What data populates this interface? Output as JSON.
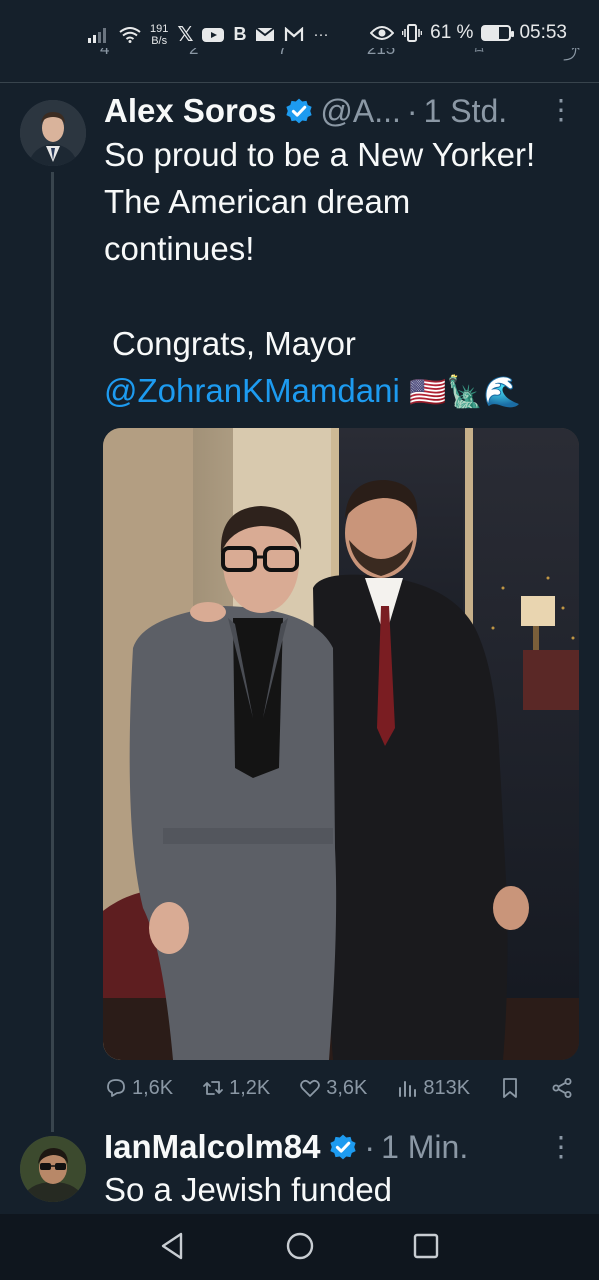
{
  "status_bar": {
    "net_speed_value": "191",
    "net_speed_unit": "B/s",
    "notification_icons": [
      "x-icon",
      "youtube-icon",
      "b-icon",
      "mail-icon",
      "gmail-icon",
      "more-dots"
    ],
    "more": "···",
    "battery": "61 %",
    "battery_level": 0.61,
    "time": "05:53"
  },
  "prev_actions": {
    "reply": "4",
    "retweet": "2",
    "like": "7",
    "views": "215"
  },
  "tweet": {
    "author": "Alex Soros",
    "handle": "@A...",
    "separator": "·",
    "time": "1 Std.",
    "text_line1": "So proud to be a New Yorker!",
    "text_line2": "The American dream",
    "text_line3": "continues!",
    "text_line4": "Congrats, Mayor",
    "mention": "@ZohranKMamdani",
    "emojis": "🇺🇸🗽🌊",
    "replies": "1,6K",
    "retweets": "1,2K",
    "likes": "3,6K",
    "views": "813K"
  },
  "reply_tweet": {
    "author": "IanMalcolm84",
    "separator": "·",
    "time": "1 Min.",
    "text": "So a Jewish funded"
  },
  "colors": {
    "background": "#15202b",
    "accent": "#1d9bf0",
    "muted": "#8b98a5",
    "text": "#f7f9f9"
  }
}
